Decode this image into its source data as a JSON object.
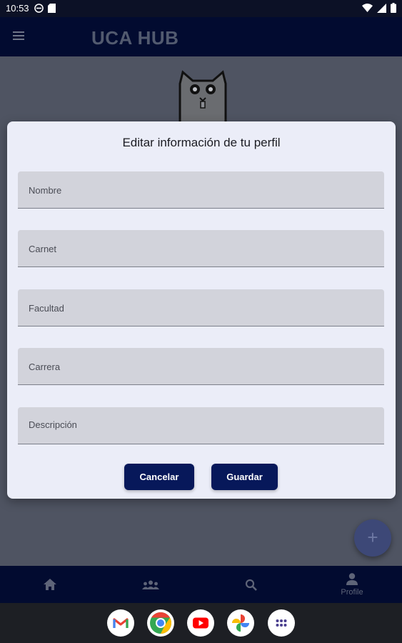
{
  "status_bar": {
    "time": "10:53",
    "left_icons": [
      "vpn-icon",
      "sd-card-icon"
    ],
    "right_icons": [
      "wifi-icon",
      "signal-icon",
      "battery-icon"
    ]
  },
  "app_bar": {
    "title": "UCA HUB",
    "menu_icon": "menu-icon"
  },
  "dialog": {
    "title": "Editar información de tu perfil",
    "fields": [
      {
        "label": "Nombre",
        "value": ""
      },
      {
        "label": "Carnet",
        "value": ""
      },
      {
        "label": "Facultad",
        "value": ""
      },
      {
        "label": "Carrera",
        "value": ""
      },
      {
        "label": "Descripción",
        "value": ""
      }
    ],
    "cancel_label": "Cancelar",
    "save_label": "Guardar"
  },
  "fab": {
    "icon": "plus-icon"
  },
  "bottom_nav": {
    "items": [
      {
        "icon": "home-icon",
        "label": ""
      },
      {
        "icon": "group-icon",
        "label": ""
      },
      {
        "icon": "search-icon",
        "label": ""
      },
      {
        "icon": "person-icon",
        "label": "Profile"
      }
    ],
    "selected": "Profile"
  },
  "dock": {
    "apps": [
      "gmail-icon",
      "chrome-icon",
      "youtube-icon",
      "photos-icon",
      "app-drawer-icon"
    ]
  },
  "colors": {
    "app_bar": "#020b30",
    "dialog_bg": "#ebedf8",
    "field_bg": "#d2d3db",
    "button": "#07185a",
    "scrim": "#4f5462"
  }
}
